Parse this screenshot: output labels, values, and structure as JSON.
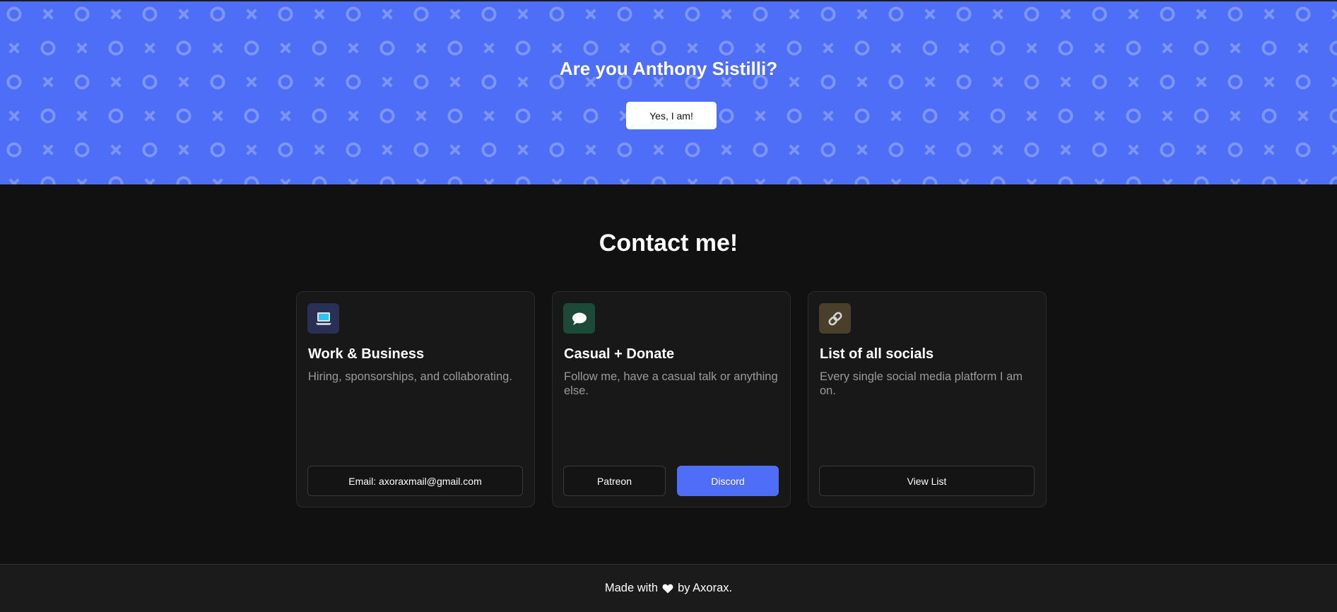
{
  "hero": {
    "title": "Are you Anthony Sistilli?",
    "button_label": "Yes, I am!",
    "bg_color": "#4f6ef7"
  },
  "contact": {
    "title": "Contact me!",
    "cards": [
      {
        "icon": "laptop-icon",
        "icon_bg": "#2a2f55",
        "title": "Work & Business",
        "description": "Hiring, sponsorships, and collaborating.",
        "buttons": [
          {
            "label": "Email: axoraxmail@gmail.com",
            "primary": false
          }
        ]
      },
      {
        "icon": "speech-bubble-icon",
        "icon_bg": "#1b4a38",
        "title": "Casual + Donate",
        "description": "Follow me, have a casual talk or anything else.",
        "buttons": [
          {
            "label": "Patreon",
            "primary": false
          },
          {
            "label": "Discord",
            "primary": true
          }
        ]
      },
      {
        "icon": "link-icon",
        "icon_bg": "#4a3f2a",
        "title": "List of all socials",
        "description": "Every single social media platform I am on.",
        "buttons": [
          {
            "label": "View List",
            "primary": false
          }
        ]
      }
    ]
  },
  "footer": {
    "prefix": "Made with",
    "icon": "heart-icon",
    "suffix": "by Axorax."
  },
  "colors": {
    "accent": "#4f6ef7",
    "page_bg": "#111111",
    "card_bg": "#181818"
  }
}
